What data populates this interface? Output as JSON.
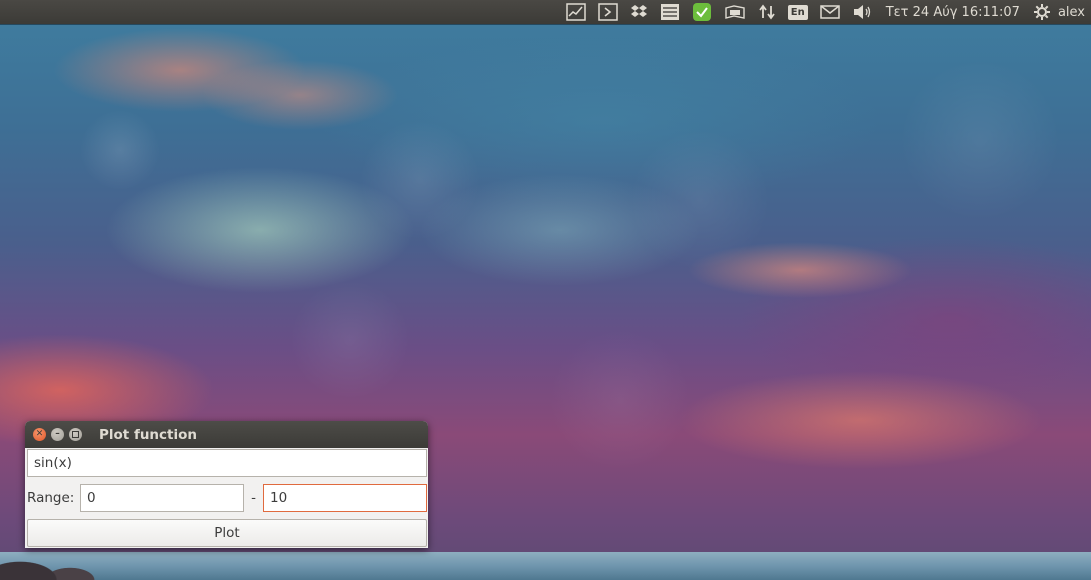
{
  "top_panel": {
    "indicators": [
      {
        "name": "system-monitor-icon"
      },
      {
        "name": "terminal-icon"
      },
      {
        "name": "dropbox-icon"
      },
      {
        "name": "notes-icon"
      },
      {
        "name": "check-icon",
        "color": "#6cbd3c"
      },
      {
        "name": "battery-icon"
      },
      {
        "name": "network-icon"
      },
      {
        "name": "keyboard-layout-icon",
        "label": "En"
      },
      {
        "name": "mail-icon"
      },
      {
        "name": "volume-icon"
      }
    ],
    "clock": "Τετ 24 Αύγ 16:11:07",
    "username": "alex"
  },
  "window": {
    "title": "Plot function",
    "function_value": "sin(x)",
    "range_label": "Range:",
    "range_min": "0",
    "range_separator": "-",
    "range_max": "10",
    "plot_label": "Plot",
    "accent_color": "#e06a3e"
  }
}
